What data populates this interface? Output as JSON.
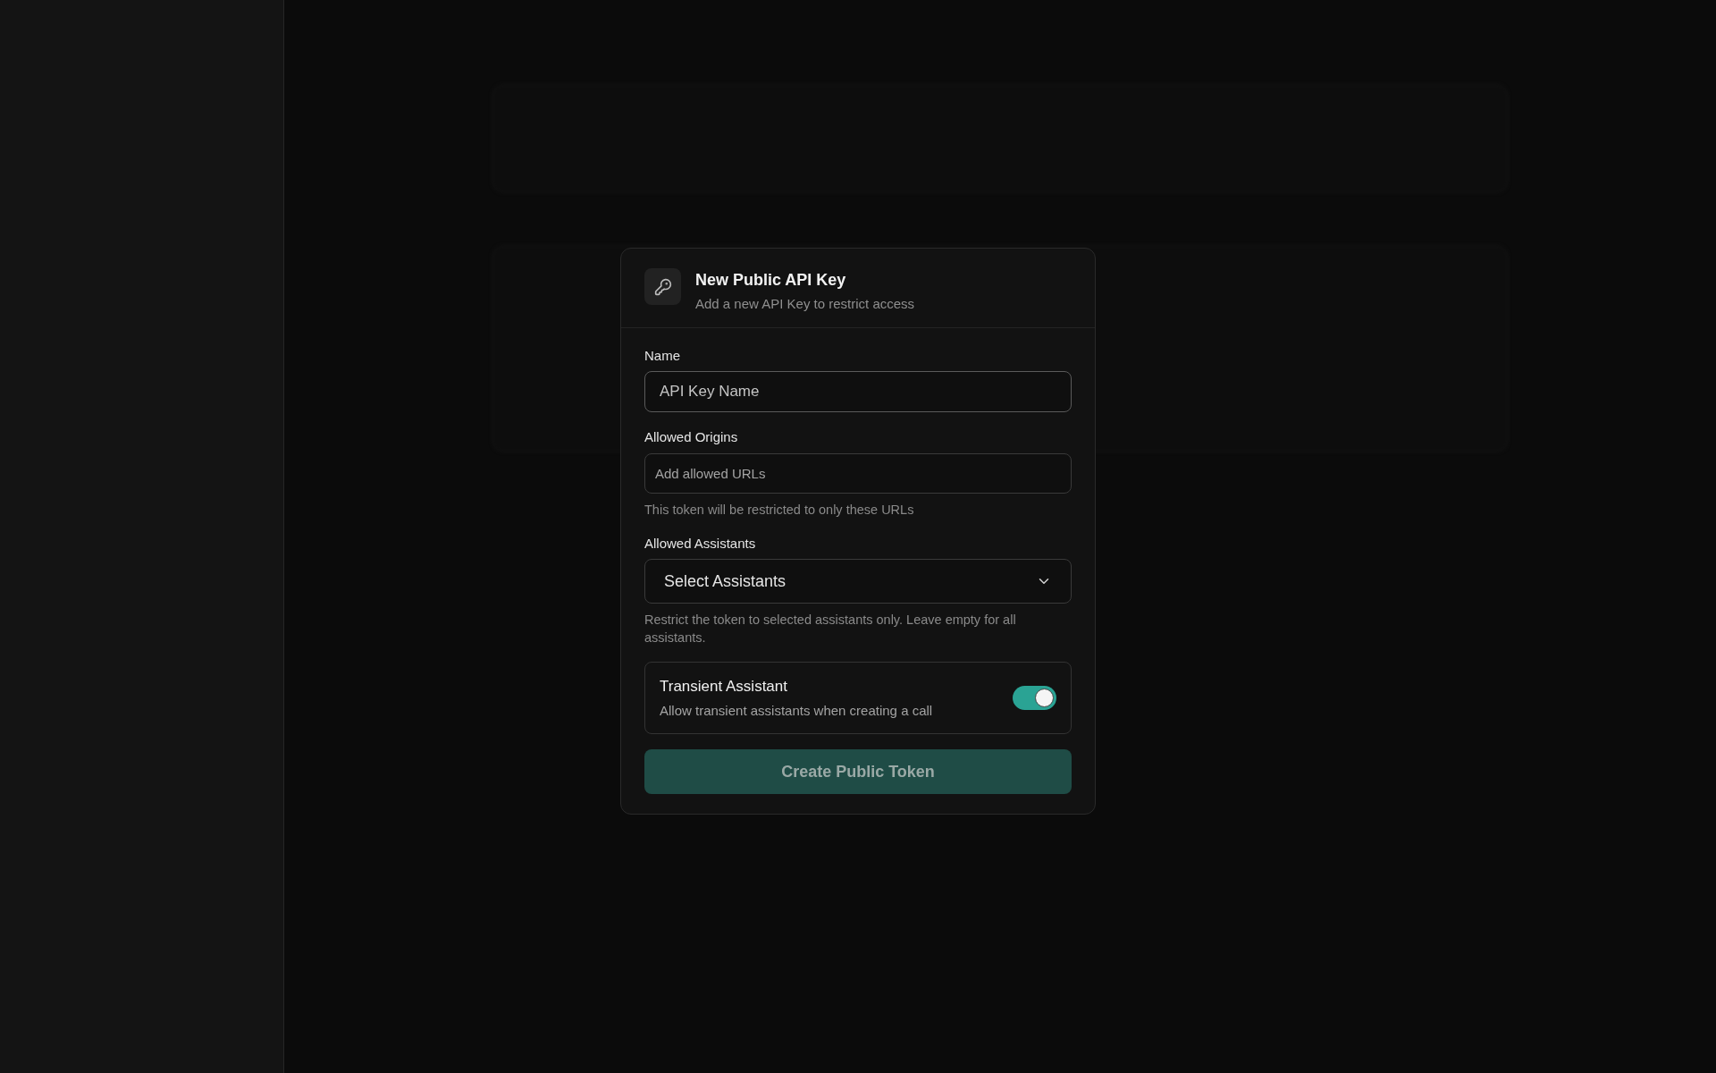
{
  "dialog": {
    "title": "New Public API Key",
    "subtitle": "Add a new API Key to restrict access",
    "fields": [
      {
        "kind": "input",
        "label": "Name",
        "placeholder": "API Key Name"
      },
      {
        "kind": "input",
        "label": "Allowed Origins",
        "placeholder": "Add allowed URLs",
        "help": "This token will be restricted to only these URLs"
      },
      {
        "kind": "select",
        "label": "Allowed Assistants",
        "value": "Select Assistants",
        "help": "Restrict the token to selected assistants only. Leave empty for all assistants."
      }
    ],
    "toggle": {
      "title": "Transient Assistant",
      "description": "Allow transient assistants when creating a call",
      "on": true
    },
    "submit": "Create Public Token"
  }
}
